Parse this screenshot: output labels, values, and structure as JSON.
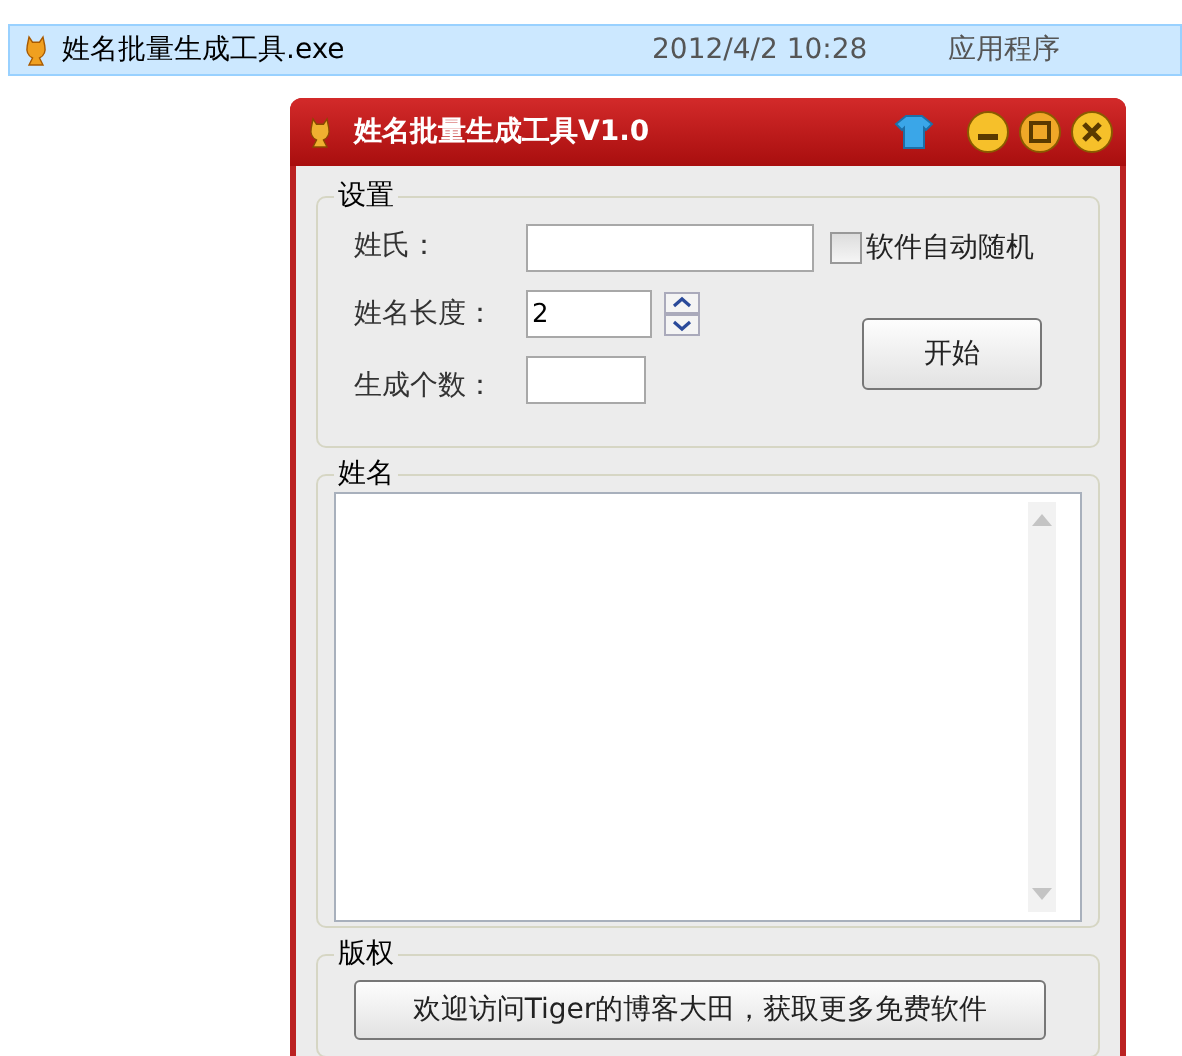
{
  "file_row": {
    "name": "姓名批量生成工具.exe",
    "date": "2012/4/2 10:28",
    "type": "应用程序",
    "selected": true
  },
  "window": {
    "title": "姓名批量生成工具V1.0"
  },
  "settings": {
    "legend": "设置",
    "surname_label": "姓氏：",
    "auto_random": {
      "label": "软件自动随机",
      "checked": false
    },
    "length_label": "姓名长度：",
    "length_value": "2",
    "count_label": "生成个数：",
    "start_button": "开始"
  },
  "names": {
    "legend": "姓名"
  },
  "copyright": {
    "legend": "版权",
    "button": "欢迎访问Tiger的博客大田，获取更多免费软件"
  }
}
